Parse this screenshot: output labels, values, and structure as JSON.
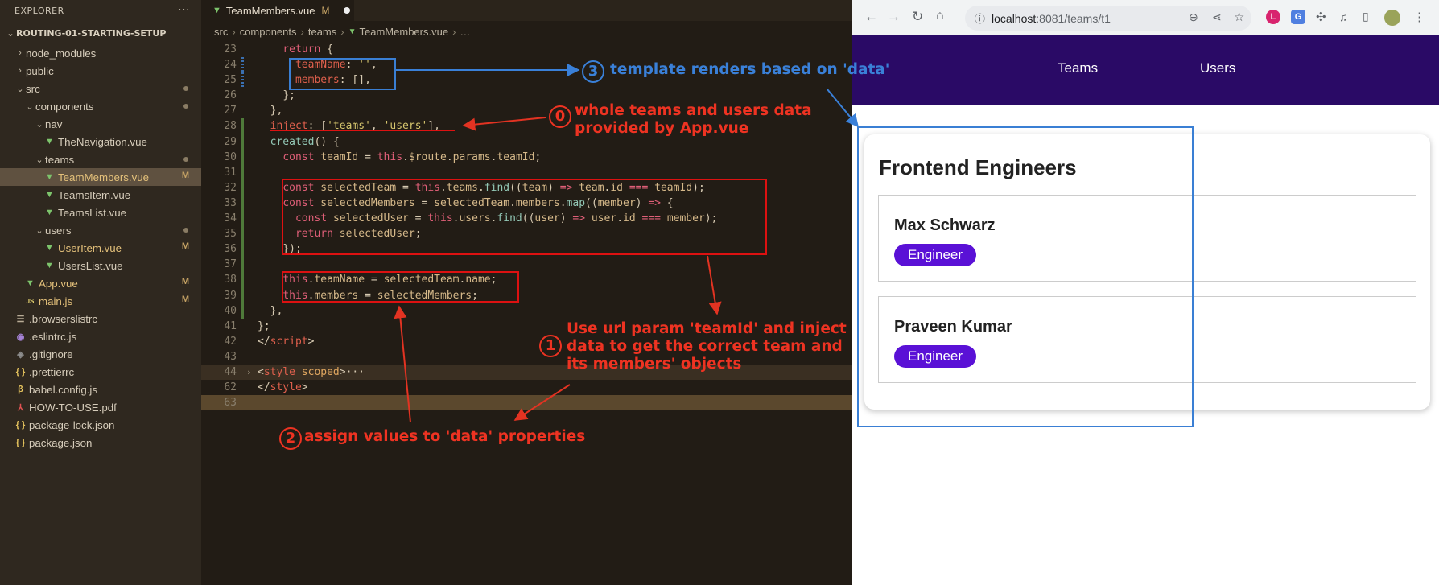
{
  "sidebar": {
    "header": "EXPLORER",
    "menu": "···",
    "project": "ROUTING-01-STARTING-SETUP",
    "items": [
      {
        "label": "node_modules",
        "depth": 1,
        "kind": "folder",
        "open": false,
        "status": ""
      },
      {
        "label": "public",
        "depth": 1,
        "kind": "folder",
        "open": false,
        "status": ""
      },
      {
        "label": "src",
        "depth": 1,
        "kind": "folder",
        "open": true,
        "status": "dot"
      },
      {
        "label": "components",
        "depth": 2,
        "kind": "folder",
        "open": true,
        "status": "dot"
      },
      {
        "label": "nav",
        "depth": 3,
        "kind": "folder",
        "open": true,
        "status": ""
      },
      {
        "label": "TheNavigation.vue",
        "depth": 4,
        "kind": "vue",
        "status": ""
      },
      {
        "label": "teams",
        "depth": 3,
        "kind": "folder",
        "open": true,
        "status": "dot"
      },
      {
        "label": "TeamMembers.vue",
        "depth": 4,
        "kind": "vue",
        "status": "M",
        "active": true
      },
      {
        "label": "TeamsItem.vue",
        "depth": 4,
        "kind": "vue",
        "status": ""
      },
      {
        "label": "TeamsList.vue",
        "depth": 4,
        "kind": "vue",
        "status": ""
      },
      {
        "label": "users",
        "depth": 3,
        "kind": "folder",
        "open": true,
        "status": "dot"
      },
      {
        "label": "UserItem.vue",
        "depth": 4,
        "kind": "vue",
        "status": "M"
      },
      {
        "label": "UsersList.vue",
        "depth": 4,
        "kind": "vue",
        "status": ""
      },
      {
        "label": "App.vue",
        "depth": 2,
        "kind": "vue",
        "status": "M"
      },
      {
        "label": "main.js",
        "depth": 2,
        "kind": "js",
        "status": "M"
      },
      {
        "label": ".browserslistrc",
        "depth": 1,
        "kind": "lst",
        "status": ""
      },
      {
        "label": ".eslintrc.js",
        "depth": 1,
        "kind": "esl",
        "status": ""
      },
      {
        "label": ".gitignore",
        "depth": 1,
        "kind": "git",
        "status": ""
      },
      {
        "label": ".prettierrc",
        "depth": 1,
        "kind": "json",
        "status": ""
      },
      {
        "label": "babel.config.js",
        "depth": 1,
        "kind": "bab",
        "status": ""
      },
      {
        "label": "HOW-TO-USE.pdf",
        "depth": 1,
        "kind": "pdf",
        "status": ""
      },
      {
        "label": "package-lock.json",
        "depth": 1,
        "kind": "json",
        "status": ""
      },
      {
        "label": "package.json",
        "depth": 1,
        "kind": "json",
        "status": ""
      }
    ]
  },
  "editor": {
    "tab": {
      "label": "TeamMembers.vue",
      "status": "M"
    },
    "breadcrumbs": [
      "src",
      "components",
      "teams",
      "TeamMembers.vue",
      "…"
    ],
    "lines": [
      {
        "n": "23",
        "tokens": [
          [
            "    ",
            "punc"
          ],
          [
            "return ",
            "kw"
          ],
          [
            "{",
            "punc"
          ]
        ]
      },
      {
        "n": "24",
        "tokens": [
          [
            "      ",
            "punc"
          ],
          [
            "teamName",
            "prop"
          ],
          [
            ": ",
            "punc"
          ],
          [
            "''",
            "str"
          ],
          [
            ",",
            "punc"
          ]
        ],
        "gutter": "mod"
      },
      {
        "n": "25",
        "tokens": [
          [
            "      ",
            "punc"
          ],
          [
            "members",
            "prop"
          ],
          [
            ": [],",
            "punc"
          ]
        ],
        "gutter": "mod"
      },
      {
        "n": "26",
        "tokens": [
          [
            "    ",
            "punc"
          ],
          [
            "};",
            "punc"
          ]
        ]
      },
      {
        "n": "27",
        "tokens": [
          [
            "  },",
            "punc"
          ]
        ]
      },
      {
        "n": "28",
        "tokens": [
          [
            "  ",
            "punc"
          ],
          [
            "inject",
            "prop"
          ],
          [
            ": [",
            "punc"
          ],
          [
            "'teams'",
            "str"
          ],
          [
            ", ",
            "punc"
          ],
          [
            "'users'",
            "str"
          ],
          [
            "],",
            "punc"
          ]
        ],
        "gutter": "add"
      },
      {
        "n": "29",
        "tokens": [
          [
            "  ",
            "punc"
          ],
          [
            "created",
            "fn"
          ],
          [
            "() {",
            "punc"
          ]
        ],
        "gutter": "add"
      },
      {
        "n": "30",
        "tokens": [
          [
            "    ",
            "punc"
          ],
          [
            "const ",
            "kw"
          ],
          [
            "teamId",
            "var"
          ],
          [
            " = ",
            "punc"
          ],
          [
            "this",
            "this"
          ],
          [
            ".",
            "punc"
          ],
          [
            "$route",
            "var"
          ],
          [
            ".",
            "punc"
          ],
          [
            "params",
            "var"
          ],
          [
            ".",
            "punc"
          ],
          [
            "teamId",
            "var"
          ],
          [
            ";",
            "punc"
          ]
        ],
        "gutter": "add"
      },
      {
        "n": "31",
        "tokens": [],
        "gutter": "add"
      },
      {
        "n": "32",
        "tokens": [
          [
            "    ",
            "punc"
          ],
          [
            "const ",
            "kw"
          ],
          [
            "selectedTeam",
            "var"
          ],
          [
            " = ",
            "punc"
          ],
          [
            "this",
            "this"
          ],
          [
            ".",
            "punc"
          ],
          [
            "teams",
            "var"
          ],
          [
            ".",
            "punc"
          ],
          [
            "find",
            "fn"
          ],
          [
            "((",
            "punc"
          ],
          [
            "team",
            "var"
          ],
          [
            ") ",
            "punc"
          ],
          [
            "=>",
            "kw"
          ],
          [
            " ",
            "punc"
          ],
          [
            "team",
            "var"
          ],
          [
            ".",
            "punc"
          ],
          [
            "id",
            "var"
          ],
          [
            " === ",
            "kw"
          ],
          [
            "teamId",
            "var"
          ],
          [
            ");",
            "punc"
          ]
        ],
        "gutter": "add"
      },
      {
        "n": "33",
        "tokens": [
          [
            "    ",
            "punc"
          ],
          [
            "const ",
            "kw"
          ],
          [
            "selectedMembers",
            "var"
          ],
          [
            " = ",
            "punc"
          ],
          [
            "selectedTeam",
            "var"
          ],
          [
            ".",
            "punc"
          ],
          [
            "members",
            "var"
          ],
          [
            ".",
            "punc"
          ],
          [
            "map",
            "fn"
          ],
          [
            "((",
            "punc"
          ],
          [
            "member",
            "var"
          ],
          [
            ") ",
            "punc"
          ],
          [
            "=>",
            "kw"
          ],
          [
            " {",
            "punc"
          ]
        ],
        "gutter": "add"
      },
      {
        "n": "34",
        "tokens": [
          [
            "      ",
            "punc"
          ],
          [
            "const ",
            "kw"
          ],
          [
            "selectedUser",
            "var"
          ],
          [
            " = ",
            "punc"
          ],
          [
            "this",
            "this"
          ],
          [
            ".",
            "punc"
          ],
          [
            "users",
            "var"
          ],
          [
            ".",
            "punc"
          ],
          [
            "find",
            "fn"
          ],
          [
            "((",
            "punc"
          ],
          [
            "user",
            "var"
          ],
          [
            ") ",
            "punc"
          ],
          [
            "=>",
            "kw"
          ],
          [
            " ",
            "punc"
          ],
          [
            "user",
            "var"
          ],
          [
            ".",
            "punc"
          ],
          [
            "id",
            "var"
          ],
          [
            " === ",
            "kw"
          ],
          [
            "member",
            "var"
          ],
          [
            ");",
            "punc"
          ]
        ],
        "gutter": "add"
      },
      {
        "n": "35",
        "tokens": [
          [
            "      ",
            "punc"
          ],
          [
            "return ",
            "kw"
          ],
          [
            "selectedUser",
            "var"
          ],
          [
            ";",
            "punc"
          ]
        ],
        "gutter": "add"
      },
      {
        "n": "36",
        "tokens": [
          [
            "    ",
            "punc"
          ],
          [
            "});",
            "punc"
          ]
        ],
        "gutter": "add"
      },
      {
        "n": "37",
        "tokens": [],
        "gutter": "add"
      },
      {
        "n": "38",
        "tokens": [
          [
            "    ",
            "punc"
          ],
          [
            "this",
            "this"
          ],
          [
            ".",
            "punc"
          ],
          [
            "teamName",
            "var"
          ],
          [
            " = ",
            "punc"
          ],
          [
            "selectedTeam",
            "var"
          ],
          [
            ".",
            "punc"
          ],
          [
            "name",
            "var"
          ],
          [
            ";",
            "punc"
          ]
        ],
        "gutter": "add"
      },
      {
        "n": "39",
        "tokens": [
          [
            "    ",
            "punc"
          ],
          [
            "this",
            "this"
          ],
          [
            ".",
            "punc"
          ],
          [
            "members",
            "var"
          ],
          [
            " = ",
            "punc"
          ],
          [
            "selectedMembers",
            "var"
          ],
          [
            ";",
            "punc"
          ]
        ],
        "gutter": "add"
      },
      {
        "n": "40",
        "tokens": [
          [
            "  },",
            "punc"
          ]
        ],
        "gutter": "add"
      },
      {
        "n": "41",
        "tokens": [
          [
            "};",
            "punc"
          ]
        ]
      },
      {
        "n": "42",
        "tokens": [
          [
            "</",
            "punc"
          ],
          [
            "script",
            "tag"
          ],
          [
            ">",
            "punc"
          ]
        ]
      },
      {
        "n": "43",
        "tokens": []
      },
      {
        "n": "44",
        "tokens": [
          [
            "<",
            "punc"
          ],
          [
            "style ",
            "tag"
          ],
          [
            "scoped",
            "attr"
          ],
          [
            ">",
            "punc"
          ],
          [
            "···",
            "punc"
          ]
        ],
        "fold": true
      },
      {
        "n": "62",
        "tokens": [
          [
            "</",
            "punc"
          ],
          [
            "style",
            "tag"
          ],
          [
            ">",
            "punc"
          ]
        ]
      },
      {
        "n": "63",
        "tokens": [],
        "cursor": true
      }
    ]
  },
  "browser": {
    "url_host": "localhost",
    "url_path": ":8081/teams/t1",
    "nav": [
      "Teams",
      "Users"
    ],
    "team_name": "Frontend Engineers",
    "members": [
      {
        "name": "Max Schwarz",
        "role": "Engineer"
      },
      {
        "name": "Praveen Kumar",
        "role": "Engineer"
      }
    ]
  },
  "annotations": {
    "n0": "0",
    "note0_line1": "whole teams and users data",
    "note0_line2": "provided by App.vue",
    "n1": "1",
    "note1_line1": "Use url param 'teamId' and inject",
    "note1_line2": "data to get the correct team and",
    "note1_line3": "its members' objects",
    "n2": "2",
    "note2": "assign values to 'data' properties",
    "n3": "3",
    "note3": "template renders based on 'data'"
  },
  "colors": {
    "annotation_red": "#e33322",
    "annotation_blue": "#3a80d8",
    "app_nav": "#2a0a66",
    "badge": "#5a11d6"
  }
}
